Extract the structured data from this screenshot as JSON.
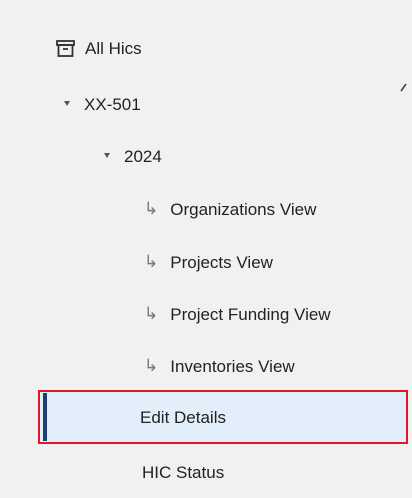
{
  "nav": {
    "root": {
      "label": "All Hics",
      "icon": "archive-box-icon"
    },
    "hic": {
      "label": "XX-501",
      "icon": "caret-down-icon"
    },
    "year": {
      "label": "2024",
      "icon": "caret-down-icon"
    },
    "views": [
      {
        "arrow": "↳",
        "label": "Organizations View"
      },
      {
        "arrow": "↳",
        "label": "Projects View"
      },
      {
        "arrow": "↳",
        "label": "Project Funding View"
      },
      {
        "arrow": "↳",
        "label": "Inventories View"
      }
    ],
    "edit_details": {
      "label": "Edit Details",
      "selected": true
    },
    "hic_status": {
      "label": "HIC Status"
    }
  },
  "colors": {
    "background": "#f1f1f1",
    "selected_background": "#e3eefb",
    "active_indicator": "#1f3f73",
    "highlight_border": "#e0191f",
    "text": "#222222"
  }
}
